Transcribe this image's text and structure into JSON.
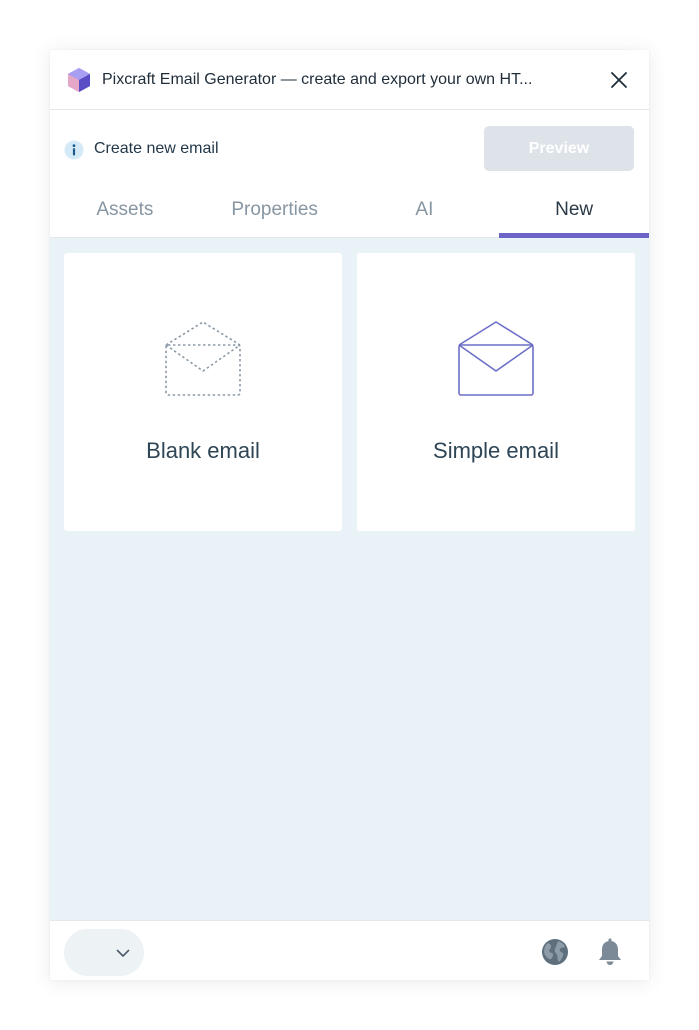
{
  "window": {
    "title": "Pixcraft Email Generator — create and export your own HT...",
    "logo_icon": "pixcraft-gem-logo",
    "close_icon": "close-icon"
  },
  "info": {
    "text": "Create new email",
    "icon": "info-icon"
  },
  "toolbar": {
    "preview_label": "Preview",
    "preview_enabled": false
  },
  "tabs": [
    {
      "label": "Assets",
      "active": false
    },
    {
      "label": "Properties",
      "active": false
    },
    {
      "label": "AI",
      "active": false
    },
    {
      "label": "New",
      "active": true
    }
  ],
  "templates": [
    {
      "label": "Blank email",
      "icon": "envelope-dashed-icon"
    },
    {
      "label": "Simple email",
      "icon": "envelope-open-icon"
    }
  ],
  "footer": {
    "dropdown_icon": "chevron-down-icon",
    "globe_icon": "globe-icon",
    "bell_icon": "bell-icon"
  },
  "colors": {
    "accent": "#6c63c7",
    "background": "#e9f2f7",
    "preview_disabled": "#dde3e8",
    "text": "#2b3a48",
    "muted_tab": "#8796a3"
  }
}
